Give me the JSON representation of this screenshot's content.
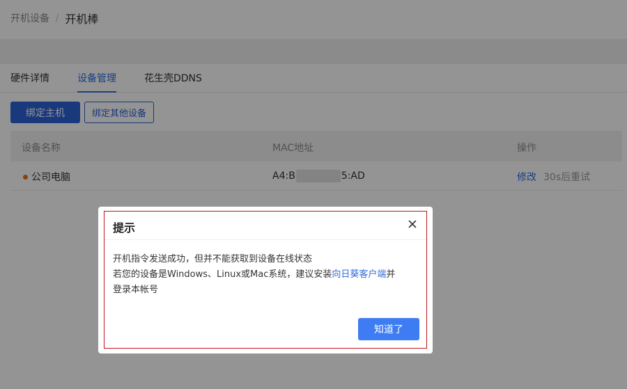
{
  "breadcrumb": {
    "parent": "开机设备",
    "separator": "/",
    "current": "开机棒"
  },
  "tabs": [
    {
      "label": "硬件详情",
      "active": false
    },
    {
      "label": "设备管理",
      "active": true
    },
    {
      "label": "花生壳DDNS",
      "active": false
    }
  ],
  "toolbar": {
    "bind_host_label": "绑定主机",
    "bind_other_label": "绑定其他设备"
  },
  "table": {
    "columns": [
      "设备名称",
      "MAC地址",
      "操作"
    ],
    "rows": [
      {
        "status_color": "#e6731c",
        "name": "公司电脑",
        "mac_prefix": "A4:B",
        "mac_suffix": "5:AD",
        "action_edit": "修改",
        "action_retry": "30s后重试"
      }
    ]
  },
  "dialog": {
    "title": "提示",
    "line1": "开机指令发送成功，但并不能获取到设备在线状态",
    "line2_prefix": "若您的设备是Windows、Linux或Mac系统，建议安装",
    "line2_link": "向日葵客户端",
    "line2_suffix": "并",
    "line3": "登录本帐号",
    "confirm_label": "知道了"
  },
  "colors": {
    "primary": "#2b62d6",
    "link": "#2b6de0",
    "status_dot": "#e6731c",
    "highlight_border": "#c0141b"
  }
}
